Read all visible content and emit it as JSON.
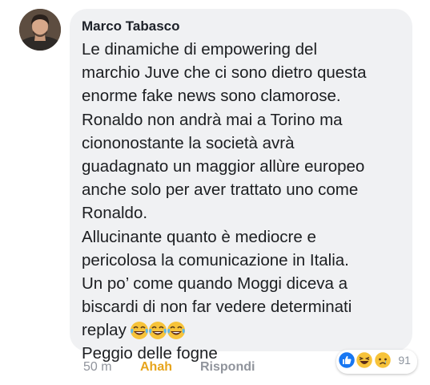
{
  "comment": {
    "author": "Marco Tabasco",
    "lines": [
      "Le dinamiche di empowering del",
      "marchio Juve che ci sono dietro questa",
      "enorme fake news sono clamorose.",
      "Ronaldo non andrà mai a Torino ma",
      "ciononostante la società avrà",
      "guadagnato un maggior allùre europeo",
      "anche solo per aver trattato uno come",
      "Ronaldo.",
      "Allucinante quanto è mediocre e",
      "pericolosa la comunicazione in Italia.",
      "Un po’ come quando Moggi diceva a",
      "biscardi di non far vedere determinati",
      "replay",
      "Peggio delle fogne"
    ],
    "inline_emoji": [
      "crying-laughing-emoji",
      "crying-laughing-emoji",
      "crying-laughing-emoji"
    ]
  },
  "footer": {
    "time": "50 m",
    "reaction_label": "Ahah",
    "reply_label": "Rispondi"
  },
  "reactions": {
    "icons": [
      "like-icon",
      "haha-icon",
      "sad-icon"
    ],
    "count": "91"
  },
  "colors": {
    "bubble_bg": "#f0f1f3",
    "author": "#1d2129",
    "meta_gray": "#90949c",
    "haha_yellow": "#e7a41c",
    "like_blue": "#1877f2"
  }
}
